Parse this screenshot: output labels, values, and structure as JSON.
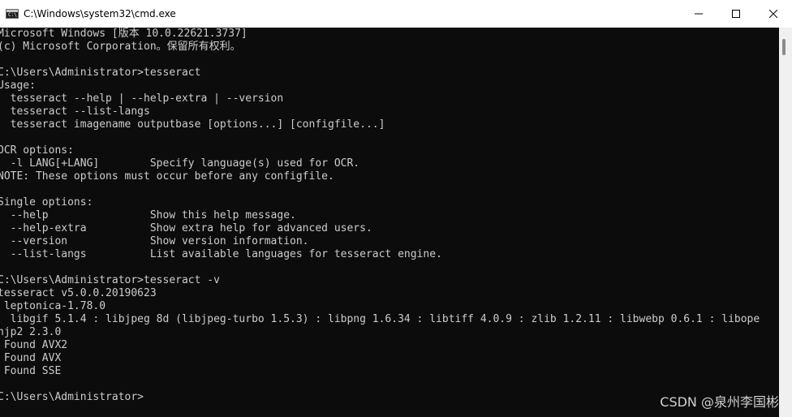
{
  "window": {
    "title": "C:\\Windows\\system32\\cmd.exe",
    "app_icon_text": "C:\\"
  },
  "controls": {
    "minimize": "minimize",
    "maximize": "maximize",
    "close": "close"
  },
  "console": {
    "lines": [
      "Microsoft Windows [版本 10.0.22621.3737]",
      "(c) Microsoft Corporation。保留所有权利。",
      "",
      "C:\\Users\\Administrator>tesseract",
      "Usage:",
      "  tesseract --help | --help-extra | --version",
      "  tesseract --list-langs",
      "  tesseract imagename outputbase [options...] [configfile...]",
      "",
      "OCR options:",
      "  -l LANG[+LANG]        Specify language(s) used for OCR.",
      "NOTE: These options must occur before any configfile.",
      "",
      "Single options:",
      "  --help                Show this help message.",
      "  --help-extra          Show extra help for advanced users.",
      "  --version             Show version information.",
      "  --list-langs          List available languages for tesseract engine.",
      "",
      "C:\\Users\\Administrator>tesseract -v",
      "tesseract v5.0.0.20190623",
      " leptonica-1.78.0",
      "  libgif 5.1.4 : libjpeg 8d (libjpeg-turbo 1.5.3) : libpng 1.6.34 : libtiff 4.0.9 : zlib 1.2.11 : libwebp 0.6.1 : libope",
      "njp2 2.3.0",
      " Found AVX2",
      " Found AVX",
      " Found SSE",
      "",
      "C:\\Users\\Administrator>"
    ]
  },
  "watermark": {
    "text": "CSDN @泉州李国彬"
  },
  "colors": {
    "console_bg": "#0c0c0c",
    "console_text": "#cccccc",
    "titlebar_bg": "#ffffff"
  }
}
